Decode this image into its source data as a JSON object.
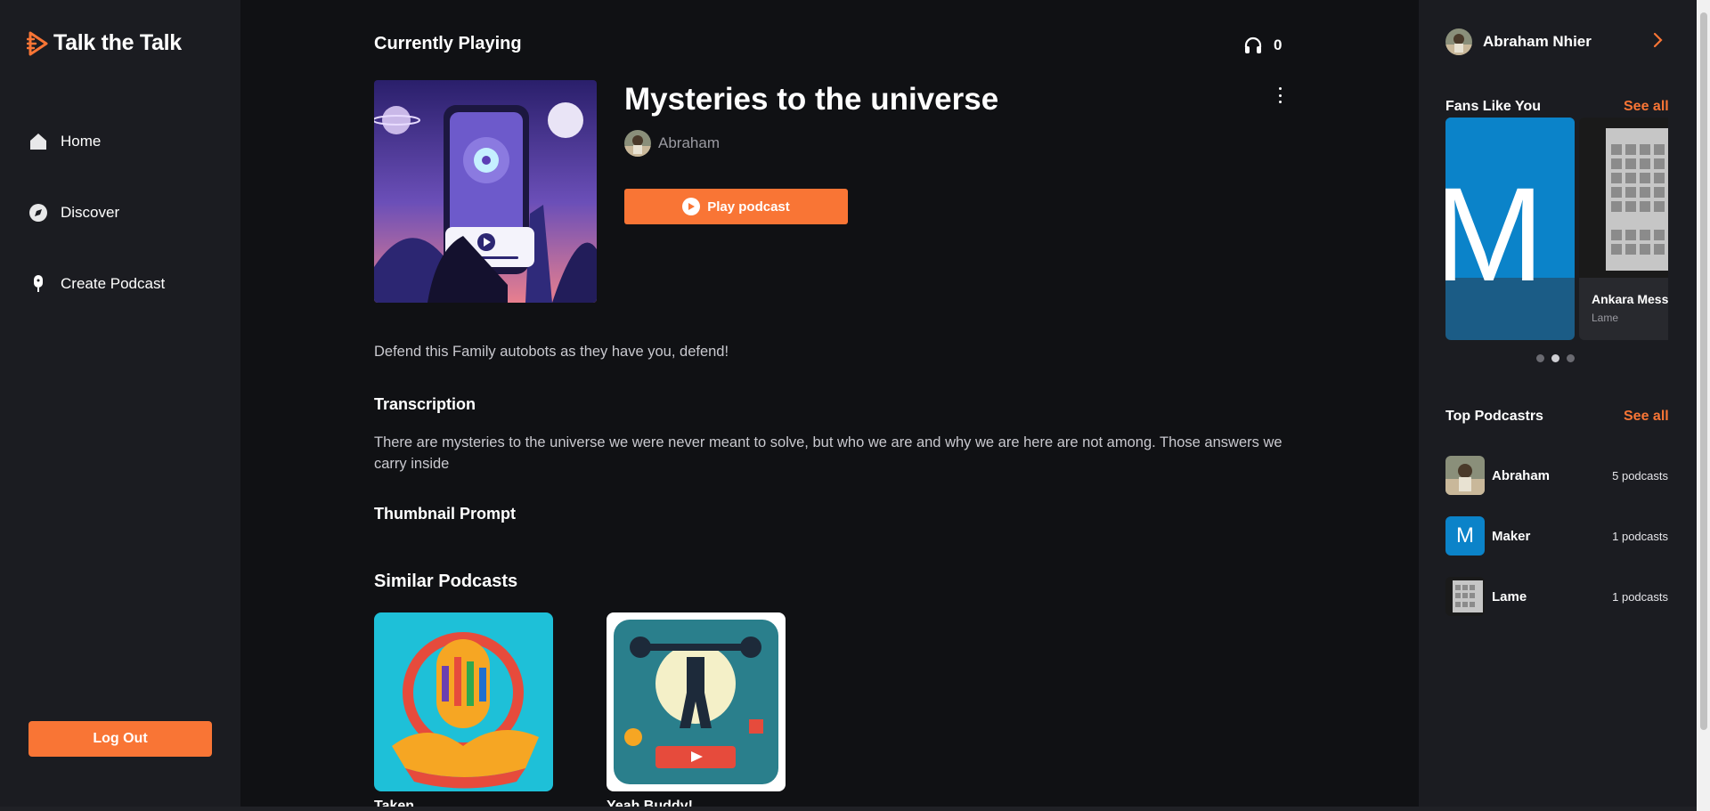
{
  "app": {
    "name": "Talk the Talk"
  },
  "sidebar": {
    "items": [
      {
        "label": "Home",
        "icon": "home-icon"
      },
      {
        "label": "Discover",
        "icon": "compass-icon"
      },
      {
        "label": "Create Podcast",
        "icon": "microphone-icon"
      }
    ],
    "logout_label": "Log Out"
  },
  "main": {
    "section_title": "Currently Playing",
    "listeners": "0",
    "podcast": {
      "title": "Mysteries to the universe",
      "author": "Abraham",
      "play_label": "Play podcast",
      "description": "Defend this Family autobots as they have you, defend!"
    },
    "transcription": {
      "heading": "Transcription",
      "text": "There are mysteries to the universe we were never meant to solve, but who we are and why we are here are not among. Those answers we carry inside"
    },
    "thumbnail_prompt": {
      "heading": "Thumbnail Prompt"
    },
    "similar": {
      "heading": "Similar Podcasts",
      "items": [
        {
          "title": "Taken"
        },
        {
          "title": "Yeah Buddy!"
        }
      ]
    }
  },
  "right": {
    "user_name": "Abraham Nhier",
    "fans": {
      "heading": "Fans Like You",
      "see_all": "See all",
      "cards": [
        {
          "letter": "M"
        },
        {
          "name": "Ankara Messi",
          "author": "Lame"
        }
      ],
      "active_dot": 1
    },
    "top": {
      "heading": "Top Podcastrs",
      "see_all": "See all",
      "items": [
        {
          "name": "Abraham",
          "count": "5 podcasts"
        },
        {
          "name": "Maker",
          "count": "1 podcasts",
          "initial": "M"
        },
        {
          "name": "Lame",
          "count": "1 podcasts"
        }
      ]
    }
  },
  "colors": {
    "accent": "#f97535",
    "background": "#101114",
    "panel": "#1b1c21"
  }
}
